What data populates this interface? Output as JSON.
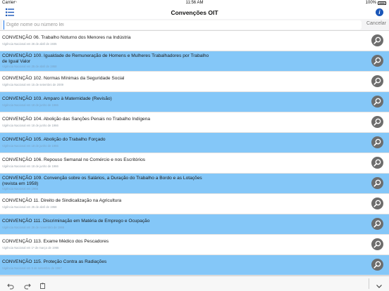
{
  "status_bar": {
    "carrier": "Carrier",
    "time": "11:56 AM",
    "battery": "100%"
  },
  "nav": {
    "title": "Convenções OIT"
  },
  "search": {
    "placeholder": "Digite nome ou número lei",
    "cancel_label": "Cancelar"
  },
  "items": [
    {
      "title": "CONVENÇÃO 06. Trabalho Noturno dos Menores na Indústria",
      "subtitle": "Vigência Nacional em 26 de abril de 1935"
    },
    {
      "title": "CONVENÇÃO 100. Igualdade de Remuneração de Homens e Mulheres Trabalhadores por Trabalho de Igual Valor",
      "subtitle": "Vigência Nacional em 25 de abril de 1958"
    },
    {
      "title": "CONVENÇÃO 102. Normas Mínimas da Seguridade Social",
      "subtitle": "Vigência Nacional em 15 de setembro de 2009"
    },
    {
      "title": "CONVENÇÃO 103. Amparo à Maternidade (Revisão)",
      "subtitle": "Vigência Nacional em 18 de junho de 1966"
    },
    {
      "title": "CONVENÇÃO 104. Abolição das Sanções Penais no Trabalho Indígena",
      "subtitle": "Vigência Nacional em 18 de junho de 1966"
    },
    {
      "title": "CONVENÇÃO 105. Abolição do Trabalho Forçado",
      "subtitle": "Vigência Nacional em 18 de junho de 1966"
    },
    {
      "title": "CONVENÇÃO 106. Repouso Semanal no Comércio e nos Escritórios",
      "subtitle": "Vigência Nacional em 18 de junho de 1966"
    },
    {
      "title": "CONVENÇÃO 109. Convenção sobre os Salários, a Duração do Trabalho a Bordo e as Lotações (revista em 1958)",
      "subtitle": "Vigência Nacional em 1966"
    },
    {
      "title": "CONVENÇÃO 11. Direito de Sindicalização na Agricultura",
      "subtitle": "Vigência Nacional em 25 de abril de 1958"
    },
    {
      "title": "CONVENÇÃO 111. Discriminação em Matéria de Emprego e Ocupação",
      "subtitle": "Vigência Nacional em 26 de novembro de 1966"
    },
    {
      "title": "CONVENÇÃO 113. Exame Médico dos Pescadores",
      "subtitle": "Vigência Nacional em 1º de março de 1966"
    },
    {
      "title": "CONVENÇÃO 115. Proteção Contra as Radiações",
      "subtitle": "Vigência Nacional em 5 de setembro de 1967"
    }
  ],
  "colors": {
    "alt_row": "#84c7f8",
    "accent": "#1a56b8",
    "button": "#6d6d6d"
  },
  "icons": {
    "nav_left": "list-icon",
    "nav_right": "info-icon",
    "row_action": "magnifier-icon",
    "toolbar": [
      "undo-icon",
      "redo-icon",
      "paste-icon",
      "chevron-down-icon"
    ]
  }
}
